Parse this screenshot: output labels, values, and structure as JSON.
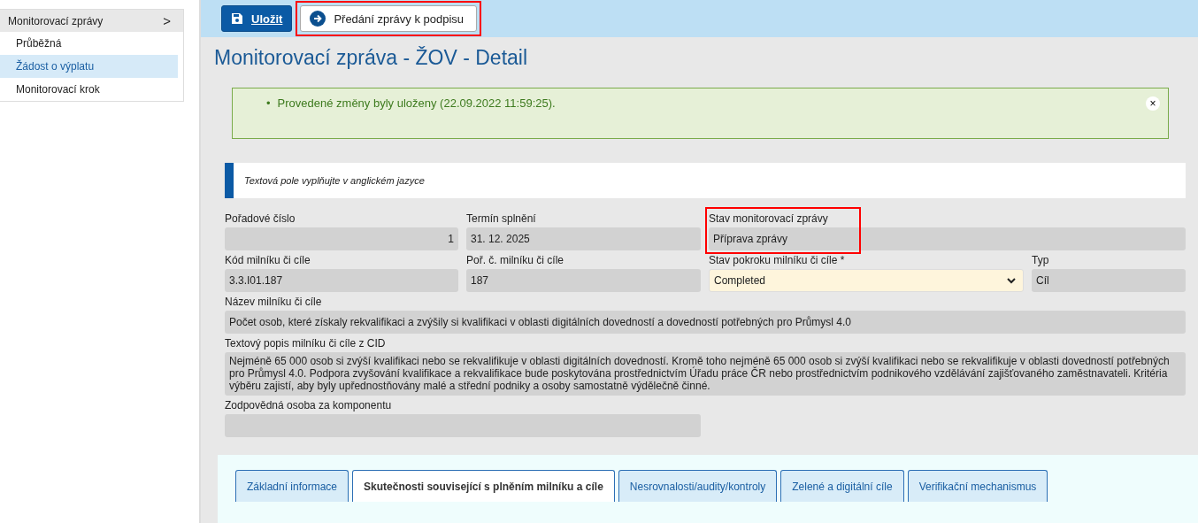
{
  "sidebar": {
    "menu_title": "Monitorovací zprávy",
    "chevron": ">",
    "items": [
      {
        "label": "Průběžná",
        "selected": false
      },
      {
        "label": "Žádost o výplatu",
        "selected": true
      },
      {
        "label": "Monitorovací krok",
        "selected": false
      }
    ]
  },
  "toolbar": {
    "buttons": [
      {
        "label": "Uložit",
        "kind": "save",
        "highlighted": false
      },
      {
        "label": "Předání zprávy k podpisu",
        "kind": "forward",
        "highlighted": true
      }
    ]
  },
  "title": "Monitorovací zpráva - ŽOV - Detail",
  "alert": {
    "bullet": "•",
    "message": "Provedené změny byly uloženy (22.09.2022 11:59:25).",
    "close": "×"
  },
  "info": "Textová pole vyplňujte v anglickém jazyce",
  "field_rows": [
    [
      {
        "label": "Pořadové číslo",
        "value": "1",
        "kind": "number",
        "highlighted": false
      },
      {
        "label": "Termín splnění",
        "value": "31. 12. 2025",
        "kind": "text",
        "highlighted": false
      },
      {
        "label": "Stav monitorovací zprávy",
        "value": "Příprava zprávy",
        "kind": "text",
        "highlighted": true
      }
    ],
    [
      {
        "label": "Kód milníku či cíle",
        "value": "3.3.I01.187",
        "kind": "text",
        "highlighted": false
      },
      {
        "label": "Poř. č. milníku či cíle",
        "value": "187",
        "kind": "text",
        "highlighted": false
      },
      {
        "label": "Stav pokroku milníku či cíle *",
        "value": "Completed",
        "kind": "select",
        "highlighted": false
      },
      {
        "label": "Typ",
        "value": "Cíl",
        "kind": "text",
        "highlighted": false
      }
    ],
    [
      {
        "label": "Název milníku či cíle",
        "value": "Počet osob, které získaly rekvalifikaci a zvýšily si kvalifikaci v oblasti digitálních dovedností a dovedností potřebných pro Průmysl 4.0",
        "kind": "text",
        "highlighted": false
      }
    ],
    [
      {
        "label": "Textový popis milníku či cíle z CID",
        "value": "Nejméně 65 000 osob si zvýší kvalifikaci nebo se rekvalifikuje v oblasti digitálních dovedností. Kromě toho nejméně 65 000 osob si zvýší kvalifikaci nebo se rekvalifikuje v oblasti dovedností potřebných pro Průmysl 4.0. Podpora zvyšování kvalifikace a rekvalifikace bude poskytována prostřednictvím Úřadu práce ČR nebo prostřednictvím podnikového vzdělávání zajišťovaného zaměstnavateli. Kritéria výběru zajistí, aby byly upřednostňovány malé a střední podniky a osoby samostatně výdělečně činné.",
        "kind": "multiline",
        "highlighted": false
      }
    ],
    [
      {
        "label": "Zodpovědná osoba za komponentu",
        "kind": "half",
        "highlighted": false
      }
    ]
  ],
  "tabs": [
    {
      "label": "Základní informace",
      "selected": false
    },
    {
      "label": "Skutečnosti související s plněním milníku a cíle",
      "selected": true
    },
    {
      "label": "Nesrovnalosti/audity/kontroly",
      "selected": false
    },
    {
      "label": "Zelené a digitální cíle",
      "selected": false
    },
    {
      "label": "Verifikační mechanismus",
      "selected": false
    }
  ]
}
